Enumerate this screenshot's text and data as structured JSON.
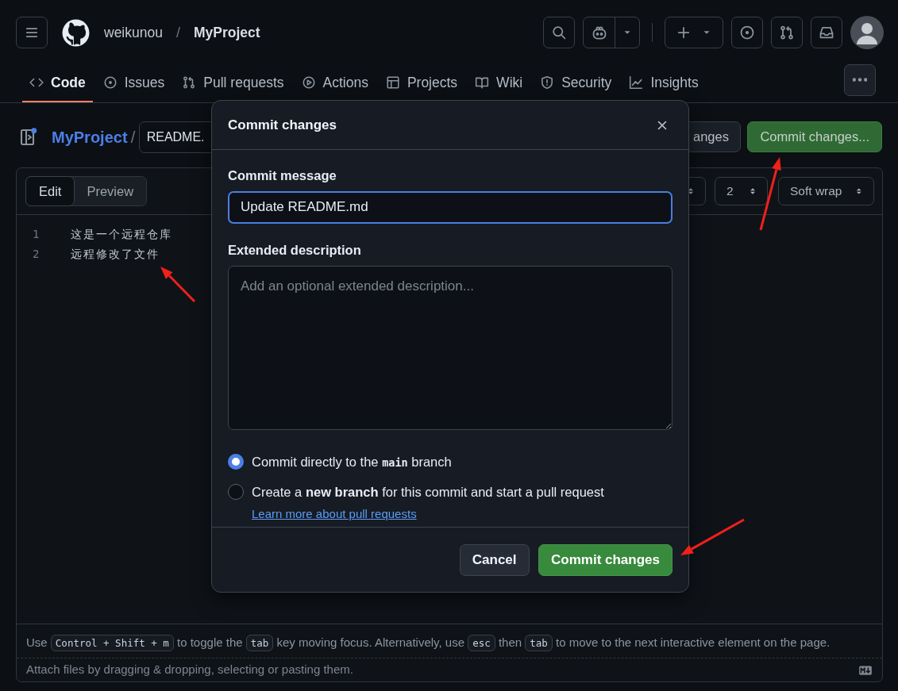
{
  "header": {
    "owner": "weikunou",
    "separator": "/",
    "repo": "MyProject"
  },
  "repo_tabs": [
    {
      "label": "Code",
      "selected": true
    },
    {
      "label": "Issues",
      "selected": false
    },
    {
      "label": "Pull requests",
      "selected": false
    },
    {
      "label": "Actions",
      "selected": false
    },
    {
      "label": "Projects",
      "selected": false
    },
    {
      "label": "Wiki",
      "selected": false
    },
    {
      "label": "Security",
      "selected": false
    },
    {
      "label": "Insights",
      "selected": false
    }
  ],
  "file_bar": {
    "repo": "MyProject",
    "separator": "/",
    "path": "README.",
    "secondary_button": "anges",
    "primary_button": "Commit changes..."
  },
  "editor": {
    "tabs": [
      {
        "label": "Edit",
        "selected": true
      },
      {
        "label": "Preview",
        "selected": false
      }
    ],
    "indent_size": "2",
    "wrap_mode": "Soft wrap",
    "lines": [
      {
        "number": "1",
        "text": "这是一个远程仓库"
      },
      {
        "number": "2",
        "text": "远程修改了文件"
      }
    ],
    "help": [
      {
        "kind": "text",
        "text": "Use "
      },
      {
        "kind": "kbd",
        "text": "Control + Shift + m"
      },
      {
        "kind": "text",
        "text": " to toggle the "
      },
      {
        "kind": "kbd",
        "text": "tab"
      },
      {
        "kind": "text",
        "text": " key moving focus. Alternatively, use "
      },
      {
        "kind": "kbd",
        "text": "esc"
      },
      {
        "kind": "text",
        "text": " then "
      },
      {
        "kind": "kbd",
        "text": "tab"
      },
      {
        "kind": "text",
        "text": " to move to the next interactive element on the page."
      }
    ],
    "attach": "Attach files by dragging & dropping, selecting or pasting them."
  },
  "dialog": {
    "title": "Commit changes",
    "message_label": "Commit message",
    "message_value": "Update README.md",
    "description_label": "Extended description",
    "description_placeholder": "Add an optional extended description...",
    "options": [
      {
        "selected": true,
        "parts": [
          {
            "kind": "text",
            "text": "Commit directly to the "
          },
          {
            "kind": "code",
            "text": "main"
          },
          {
            "kind": "text",
            "text": " branch"
          }
        ]
      },
      {
        "selected": false,
        "parts": [
          {
            "kind": "text",
            "text": "Create a "
          },
          {
            "kind": "bold",
            "text": "new branch"
          },
          {
            "kind": "text",
            "text": " for this commit and start a pull request "
          },
          {
            "kind": "link",
            "text": "Learn more about pull requests"
          }
        ]
      }
    ],
    "cancel_button": "Cancel",
    "commit_button": "Commit changes"
  },
  "annotations": [
    {
      "kind": "arrow"
    },
    {
      "kind": "arrow"
    },
    {
      "kind": "arrow"
    }
  ]
}
